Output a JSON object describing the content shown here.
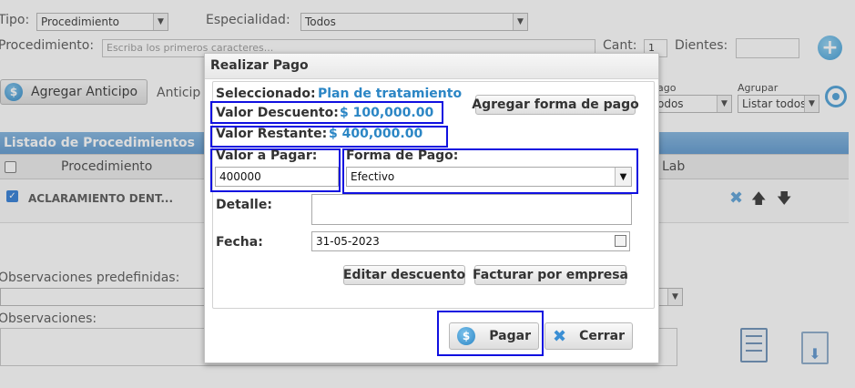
{
  "form": {
    "tipo_label": "Tipo:",
    "tipo_value": "Procedimiento",
    "especialidad_label": "Especialidad:",
    "especialidad_value": "Todos",
    "procedimiento_label": "Procedimiento:",
    "procedimiento_placeholder": "Escriba los primeros caracteres...",
    "cant_label": "Cant:",
    "cant_value": "1",
    "dientes_label": "Dientes:",
    "dientes_value": ""
  },
  "actions": {
    "agregar_anticipo": "Agregar Anticipo",
    "anticipo_label": "Anticip",
    "pago_label": "ago",
    "pago_value": "odos",
    "agrupar_label": "Agrupar",
    "agrupar_value": "Listar todos"
  },
  "list": {
    "title": "Listado de Procedimientos",
    "col_procedimiento": "Procedimiento",
    "col_lab": "Lab",
    "rows": [
      {
        "name": "ACLARAMIENTO DENT...",
        "checked": true
      }
    ]
  },
  "obs": {
    "predefinidas_label": "Observaciones predefinidas:",
    "observaciones_label": "Observaciones:"
  },
  "modal": {
    "title": "Realizar Pago",
    "seleccionado_label": "Seleccionado:",
    "seleccionado_value": "Plan de tratamiento",
    "agregar_forma_pago": "Agregar forma de pago",
    "descuento_label": "Valor Descuento:",
    "descuento_value": "$ 100,000.00",
    "restante_label": "Valor Restante:",
    "restante_value": "$ 400,000.00",
    "valor_pagar_label": "Valor a Pagar:",
    "valor_pagar_value": "400000",
    "forma_pago_label": "Forma de Pago:",
    "forma_pago_value": "Efectivo",
    "detalle_label": "Detalle:",
    "detalle_value": "",
    "fecha_label": "Fecha:",
    "fecha_value": "31-05-2023",
    "editar_descuento": "Editar descuento",
    "facturar_empresa": "Facturar por empresa",
    "pagar": "Pagar",
    "cerrar": "Cerrar"
  },
  "colors": {
    "accent": "#2b86c5",
    "highlight": "#1010e0",
    "header_blue": "#6aa3d6"
  }
}
